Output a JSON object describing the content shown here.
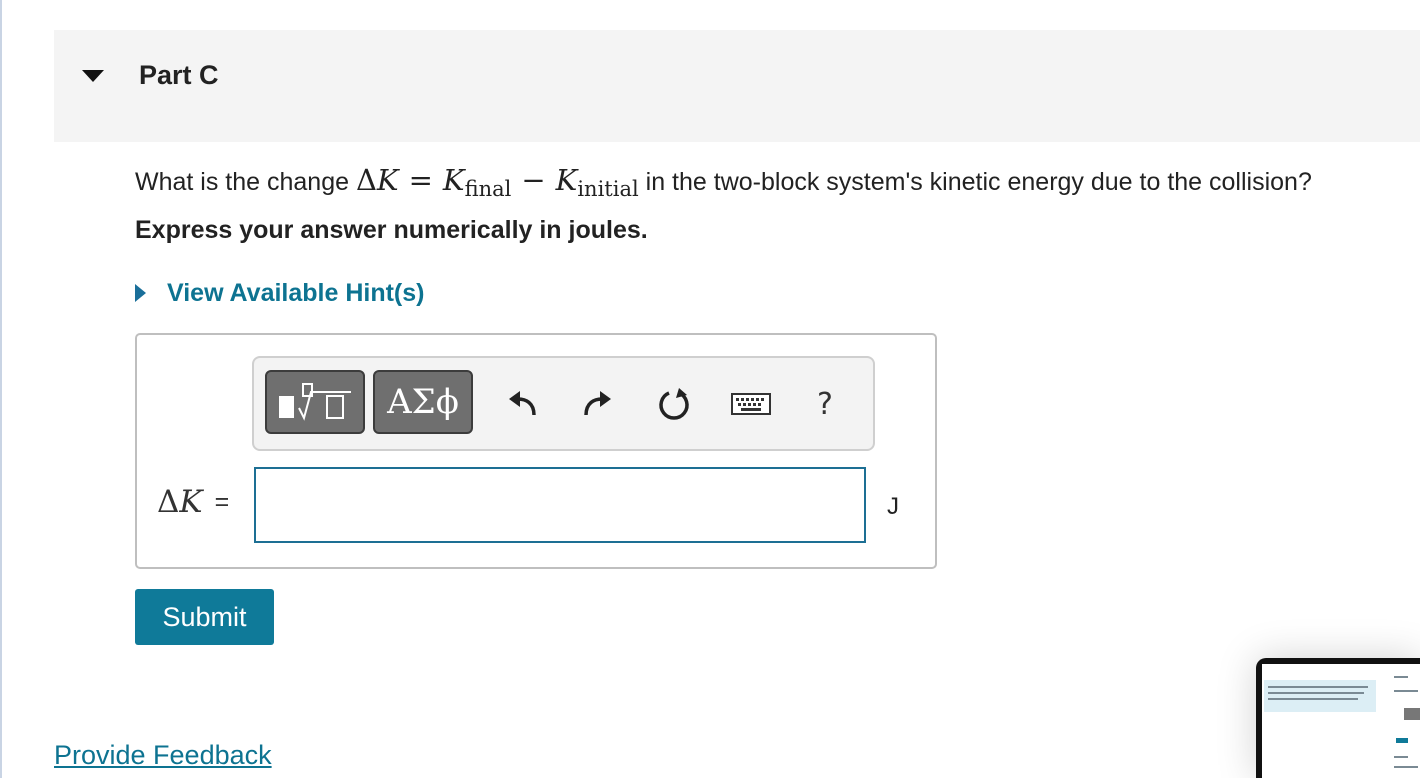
{
  "part": {
    "title": "Part C"
  },
  "question": {
    "prefix": "What is the change ",
    "delta": "Δ",
    "K": "K",
    "equals": "=",
    "final_sub": "final",
    "minus": "−",
    "initial_sub": "initial",
    "suffix": " in the two-block system's kinetic energy due to the collision?"
  },
  "instruction": "Express your answer numerically in joules.",
  "hint": {
    "label": "View Available Hint(s)"
  },
  "toolbar": {
    "greek_label": "ΑΣϕ",
    "help_label": "?",
    "icons": [
      "templates-icon",
      "greek-icon",
      "undo-icon",
      "redo-icon",
      "reset-icon",
      "keyboard-icon",
      "help-icon"
    ]
  },
  "answer": {
    "label_delta": "Δ",
    "label_K": "K",
    "label_eq": "=",
    "value": "",
    "unit": "J"
  },
  "submit_label": "Submit",
  "feedback_label": "Provide Feedback",
  "colors": {
    "accent": "#0f7a99",
    "link": "#0d7391",
    "header_bg": "#f4f4f4"
  }
}
